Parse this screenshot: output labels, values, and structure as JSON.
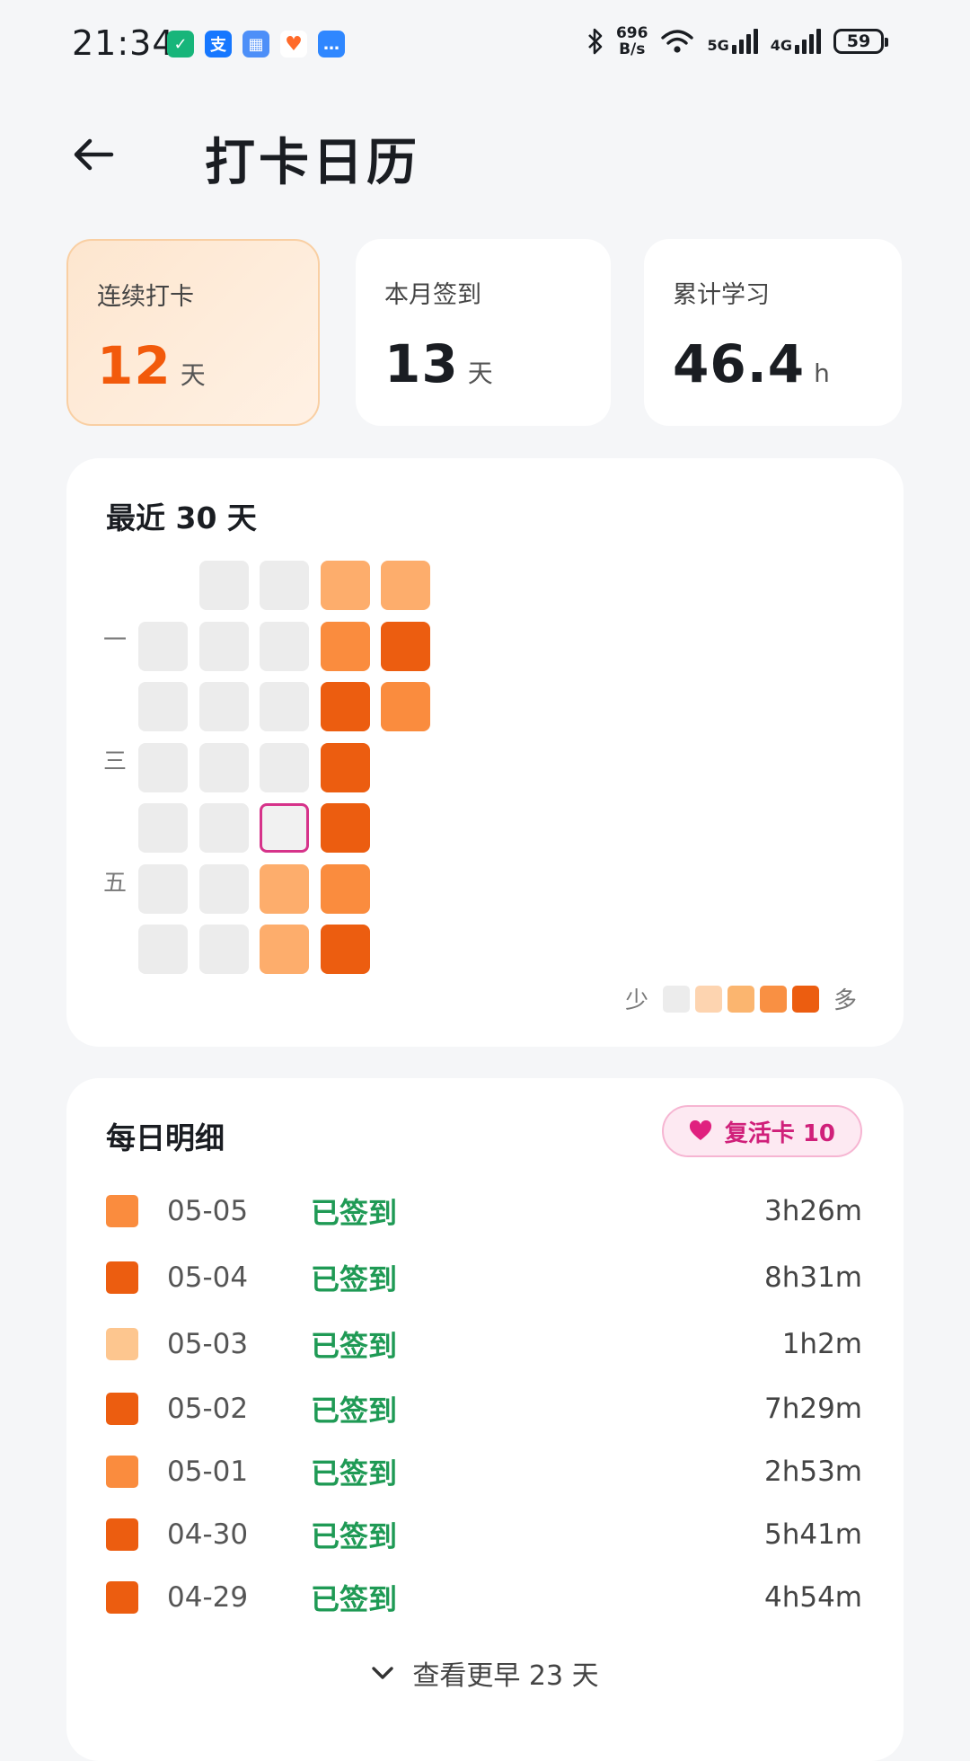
{
  "status_bar": {
    "time": "21:34",
    "net_speed_value": "696",
    "net_speed_unit": "B/s",
    "signal1_label": "5G",
    "signal2_label": "4G",
    "battery": "59"
  },
  "header": {
    "title": "打卡日历"
  },
  "stats": [
    {
      "label": "连续打卡",
      "value": "12",
      "unit": "天"
    },
    {
      "label": "本月签到",
      "value": "13",
      "unit": "天"
    },
    {
      "label": "累计学习",
      "value": "46.4",
      "unit": "h"
    }
  ],
  "heatmap": {
    "title": "最近 30 天",
    "day_labels": [
      "一",
      "三",
      "五"
    ],
    "levels": {
      "0": "#ececec",
      "1": "#fdc68f",
      "2": "#fdad6c",
      "3": "#fa8c3e",
      "4": "#ec5d10"
    },
    "columns": [
      [
        null,
        0,
        0,
        0,
        0,
        0,
        0
      ],
      [
        0,
        0,
        0,
        0,
        0,
        0,
        0
      ],
      [
        0,
        0,
        0,
        0,
        "today",
        2,
        2
      ],
      [
        2,
        3,
        4,
        4,
        4,
        3,
        4
      ],
      [
        2,
        4,
        3,
        null,
        null,
        null,
        null
      ]
    ],
    "today_border": "#d6338a",
    "legend_less": "少",
    "legend_more": "多",
    "legend_colors": [
      "#ececec",
      "#fdd4b0",
      "#fbb56f",
      "#f99043",
      "#ec5d10"
    ]
  },
  "daily": {
    "title": "每日明细",
    "revive_label": "复活卡 10",
    "rows": [
      {
        "date": "05-05",
        "status": "已签到",
        "duration": "3h26m",
        "color": "#fa8c3e"
      },
      {
        "date": "05-04",
        "status": "已签到",
        "duration": "8h31m",
        "color": "#ec5d10"
      },
      {
        "date": "05-03",
        "status": "已签到",
        "duration": "1h2m",
        "color": "#fdc68f"
      },
      {
        "date": "05-02",
        "status": "已签到",
        "duration": "7h29m",
        "color": "#ec5d10"
      },
      {
        "date": "05-01",
        "status": "已签到",
        "duration": "2h53m",
        "color": "#fa8c3e"
      },
      {
        "date": "04-30",
        "status": "已签到",
        "duration": "5h41m",
        "color": "#ec5d10"
      },
      {
        "date": "04-29",
        "status": "已签到",
        "duration": "4h54m",
        "color": "#ec5d10"
      }
    ],
    "more_label": "查看更早 23 天"
  }
}
